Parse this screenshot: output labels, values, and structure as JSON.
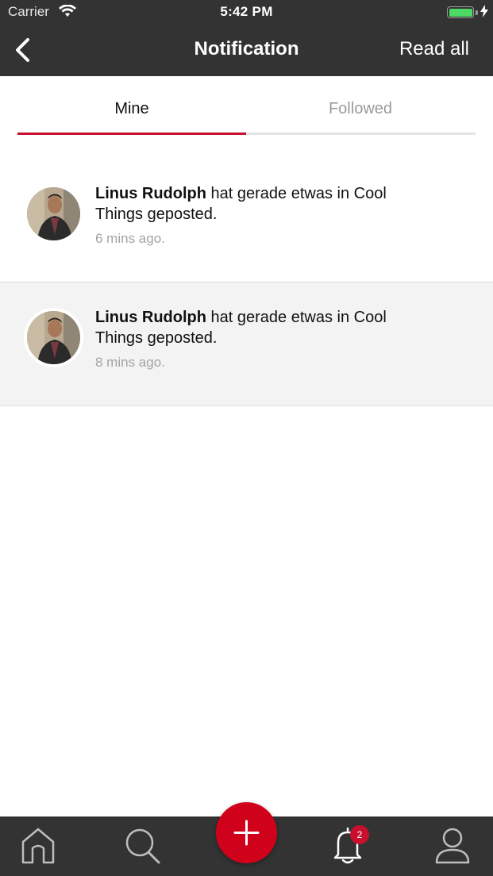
{
  "status_bar": {
    "carrier": "Carrier",
    "time": "5:42 PM"
  },
  "nav": {
    "title": "Notification",
    "read_all": "Read all",
    "back_icon": "chevron-left-icon"
  },
  "tabs": [
    {
      "label": "Mine",
      "active": true
    },
    {
      "label": "Followed",
      "active": false
    }
  ],
  "notifications": [
    {
      "name": "Linus Rudolph",
      "message": " hat gerade etwas in Cool Things geposted.",
      "time": "6 mins ago.",
      "read": true
    },
    {
      "name": "Linus Rudolph",
      "message": " hat gerade etwas in Cool Things geposted.",
      "time": "8 mins ago.",
      "read": false
    }
  ],
  "tab_bar": {
    "items": [
      "home-icon",
      "search-icon",
      "add-icon",
      "bell-icon",
      "profile-icon"
    ],
    "notification_badge": "2"
  },
  "colors": {
    "accent": "#c8102e",
    "bar": "#333333",
    "unread_bg": "#f3f3f3"
  }
}
